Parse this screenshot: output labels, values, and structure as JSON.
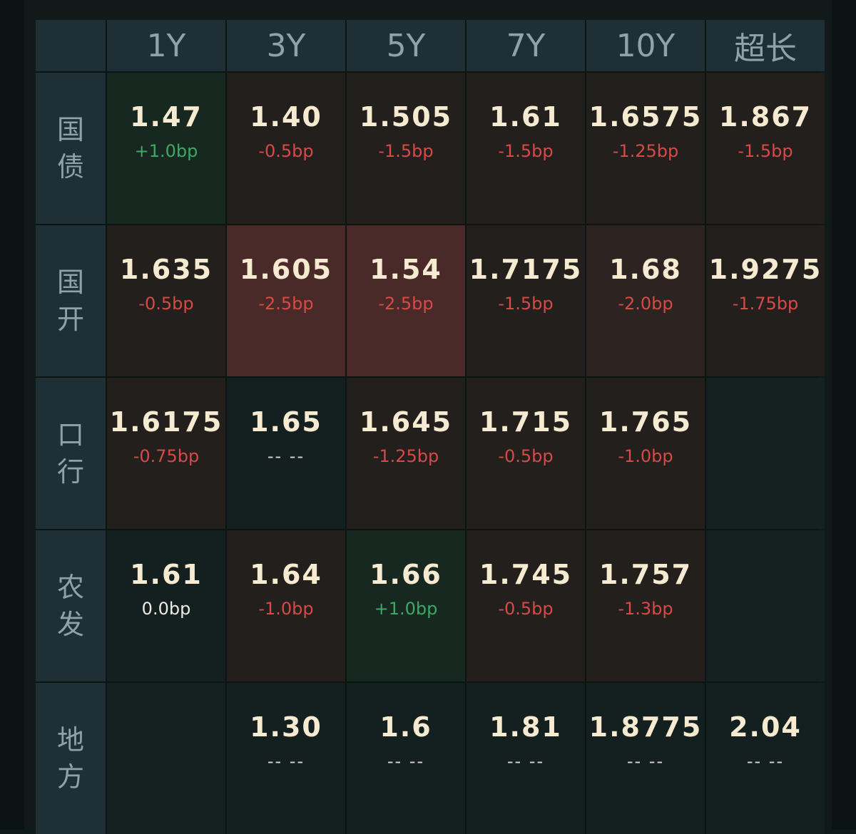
{
  "header": {
    "corner": "",
    "columns": [
      "1Y",
      "3Y",
      "5Y",
      "7Y",
      "10Y",
      "超长"
    ]
  },
  "rows": [
    {
      "label": [
        "国",
        "债"
      ],
      "cells": [
        {
          "value": "1.47",
          "change": "+1.0bp",
          "dir": "pos",
          "tone": "green"
        },
        {
          "value": "1.40",
          "change": "-0.5bp",
          "dir": "neg",
          "tone": "red-light"
        },
        {
          "value": "1.505",
          "change": "-1.5bp",
          "dir": "neg",
          "tone": "red-light"
        },
        {
          "value": "1.61",
          "change": "-1.5bp",
          "dir": "neg",
          "tone": "red-light"
        },
        {
          "value": "1.6575",
          "change": "-1.25bp",
          "dir": "neg",
          "tone": "red-light"
        },
        {
          "value": "1.867",
          "change": "-1.5bp",
          "dir": "neg",
          "tone": "red-light"
        }
      ]
    },
    {
      "label": [
        "国",
        "开"
      ],
      "cells": [
        {
          "value": "1.635",
          "change": "-0.5bp",
          "dir": "neg",
          "tone": "red-light"
        },
        {
          "value": "1.605",
          "change": "-2.5bp",
          "dir": "neg",
          "tone": "red-strong"
        },
        {
          "value": "1.54",
          "change": "-2.5bp",
          "dir": "neg",
          "tone": "red-strong"
        },
        {
          "value": "1.7175",
          "change": "-1.5bp",
          "dir": "neg",
          "tone": "red-light"
        },
        {
          "value": "1.68",
          "change": "-2.0bp",
          "dir": "neg",
          "tone": "red-med"
        },
        {
          "value": "1.9275",
          "change": "-1.75bp",
          "dir": "neg",
          "tone": "red-light"
        }
      ]
    },
    {
      "label": [
        "口",
        "行"
      ],
      "cells": [
        {
          "value": "1.6175",
          "change": "-0.75bp",
          "dir": "neg",
          "tone": "red-light"
        },
        {
          "value": "1.65",
          "change": "-- --",
          "dir": "none",
          "tone": "dark"
        },
        {
          "value": "1.645",
          "change": "-1.25bp",
          "dir": "neg",
          "tone": "red-light"
        },
        {
          "value": "1.715",
          "change": "-0.5bp",
          "dir": "neg",
          "tone": "red-light"
        },
        {
          "value": "1.765",
          "change": "-1.0bp",
          "dir": "neg",
          "tone": "red-light"
        },
        {
          "value": "",
          "change": "",
          "dir": "none",
          "tone": "empty"
        }
      ]
    },
    {
      "label": [
        "农",
        "发"
      ],
      "cells": [
        {
          "value": "1.61",
          "change": "0.0bp",
          "dir": "zero",
          "tone": "dark"
        },
        {
          "value": "1.64",
          "change": "-1.0bp",
          "dir": "neg",
          "tone": "red-light"
        },
        {
          "value": "1.66",
          "change": "+1.0bp",
          "dir": "pos",
          "tone": "green"
        },
        {
          "value": "1.745",
          "change": "-0.5bp",
          "dir": "neg",
          "tone": "red-light"
        },
        {
          "value": "1.757",
          "change": "-1.3bp",
          "dir": "neg",
          "tone": "red-light"
        },
        {
          "value": "",
          "change": "",
          "dir": "none",
          "tone": "empty"
        }
      ]
    },
    {
      "label": [
        "地",
        "方"
      ],
      "cells": [
        {
          "value": "",
          "change": "",
          "dir": "none",
          "tone": "empty"
        },
        {
          "value": "1.30",
          "change": "-- --",
          "dir": "none",
          "tone": "dark"
        },
        {
          "value": "1.6",
          "change": "-- --",
          "dir": "none",
          "tone": "dark"
        },
        {
          "value": "1.81",
          "change": "-- --",
          "dir": "none",
          "tone": "dark"
        },
        {
          "value": "1.8775",
          "change": "-- --",
          "dir": "none",
          "tone": "dark"
        },
        {
          "value": "2.04",
          "change": "-- --",
          "dir": "none",
          "tone": "dark"
        }
      ]
    }
  ],
  "colors": {
    "background": "#0f1a19",
    "header_bg": "#1e3036",
    "header_text": "#8fa3a6",
    "value_text": "#f6ebd1",
    "negative": "#d64a47",
    "positive": "#3fa765",
    "cell_red_strong": "#4a2a29",
    "cell_red_medium": "#2d2321",
    "cell_red_light": "#221f1c",
    "cell_green": "#172821",
    "cell_dark": "#14201f"
  }
}
